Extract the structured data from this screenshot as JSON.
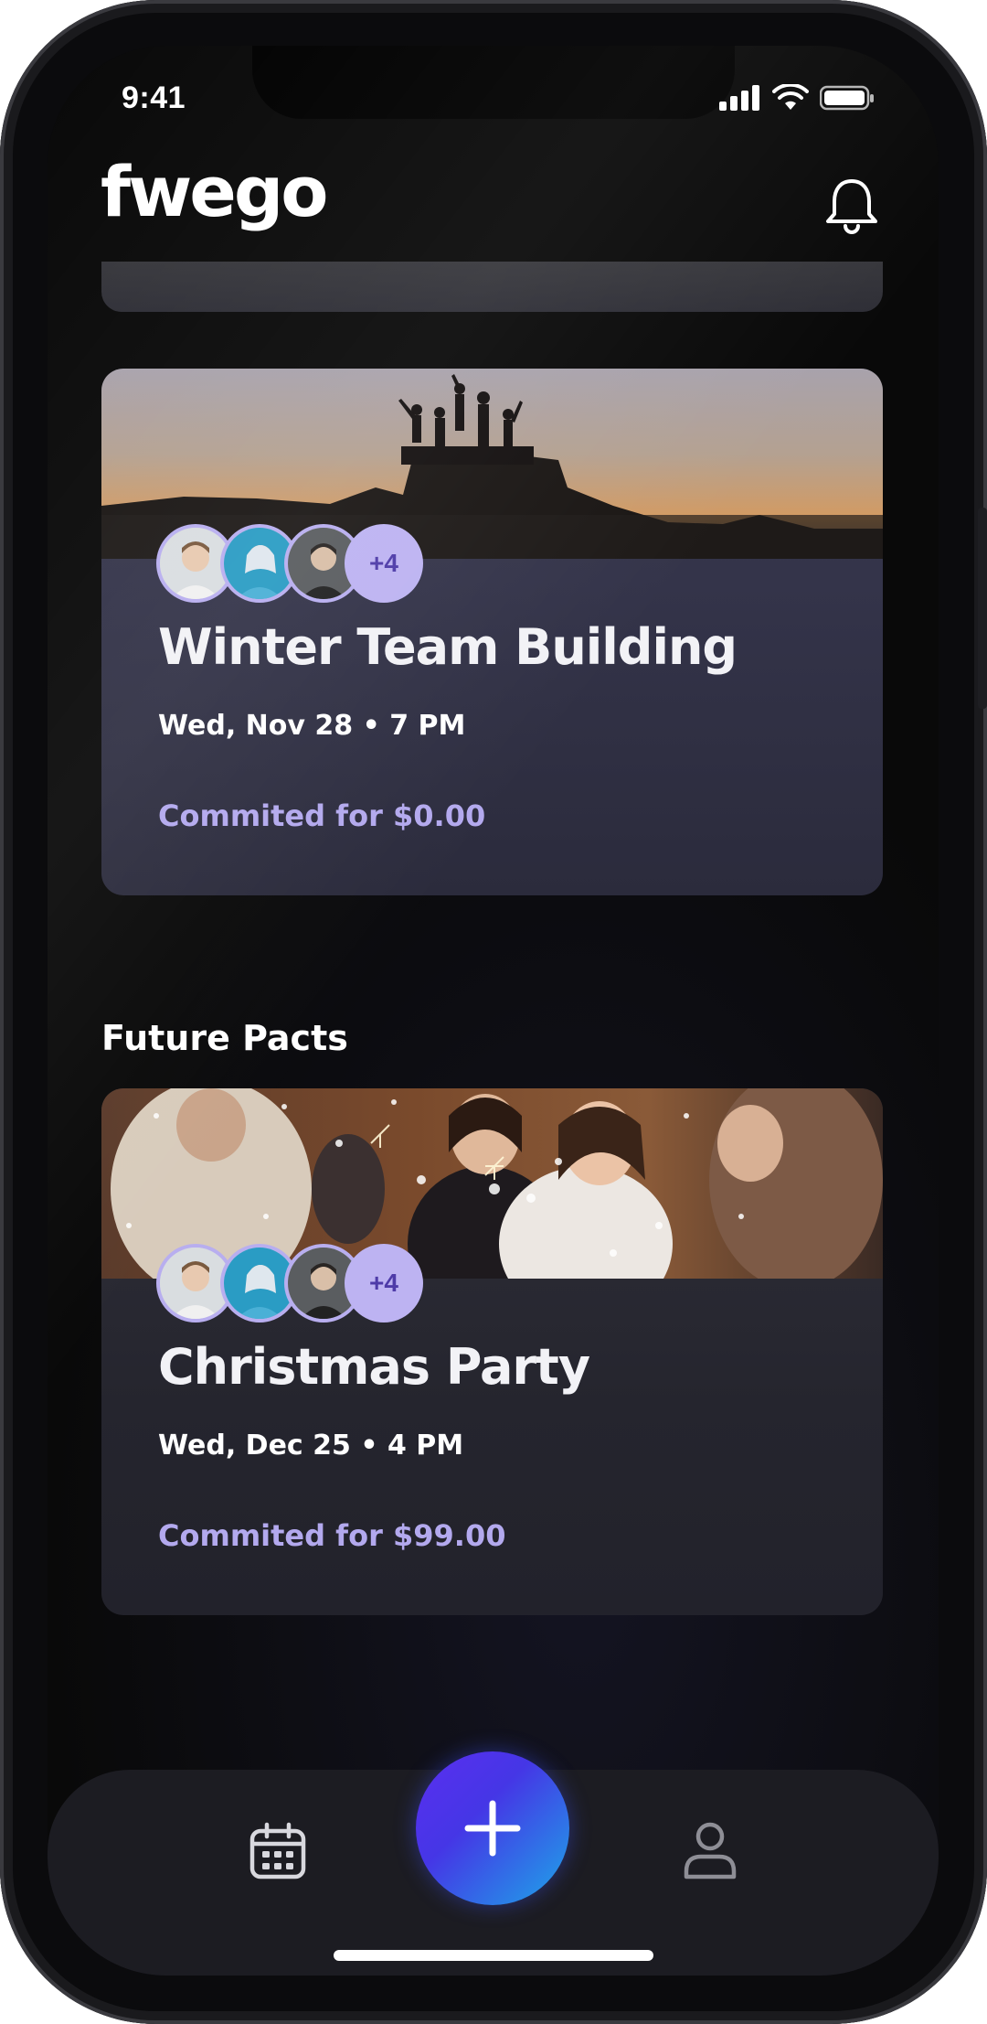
{
  "status_bar": {
    "time": "9:41"
  },
  "header": {
    "logo_text": "fwego",
    "notification_icon": "bell-icon"
  },
  "current_cards": [
    {
      "title": "Winter Team Building",
      "date": "Wed, Nov 28 • 7 PM",
      "commitment": "Commited for $0.00",
      "extra_participants": "+4",
      "image": "silhouettes-on-mountain-sunset"
    }
  ],
  "future_section": {
    "title": "Future Pacts",
    "cards": [
      {
        "title": "Christmas Party",
        "date": "Wed, Dec 25 • 4 PM",
        "commitment": "Commited for $99.00",
        "extra_participants": "+4",
        "image": "people-with-sparklers"
      }
    ]
  },
  "bottom_nav": {
    "calendar_icon": "calendar-icon",
    "add_icon": "plus-icon",
    "profile_icon": "user-icon"
  },
  "colors": {
    "accent": "#b3a9ee",
    "fab_gradient_start": "#5b2ff0",
    "fab_gradient_end": "#1da7e8",
    "background": "#090909"
  }
}
